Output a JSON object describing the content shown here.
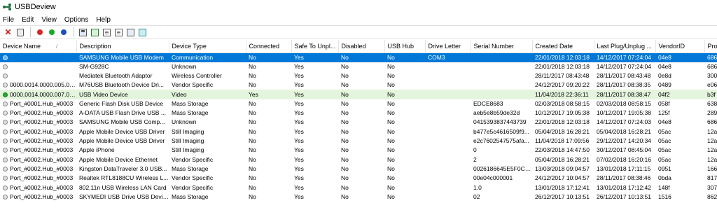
{
  "window": {
    "title": "USBDeview"
  },
  "menu": [
    "File",
    "Edit",
    "View",
    "Options",
    "Help"
  ],
  "toolbar": {
    "icons": [
      "uninstall-icon",
      "trash-icon",
      "red-dot-icon",
      "green-dot-icon",
      "blue-dot-icon",
      "save-icon",
      "refresh-icon",
      "copy-icon",
      "report-icon",
      "properties-icon",
      "exit-icon"
    ]
  },
  "table": {
    "sort_indicator": "/",
    "columns": [
      "Device Name",
      "Description",
      "Device Type",
      "Connected",
      "Safe To Unpl...",
      "Disabled",
      "USB Hub",
      "Drive Letter",
      "Serial Number",
      "Created Date",
      "Last Plug/Unplug ...",
      "VendorID",
      "Pro"
    ],
    "rows": [
      {
        "state": "selected",
        "cells": [
          "",
          "SAMSUNG Mobile USB Modem",
          "Communication",
          "No",
          "Yes",
          "No",
          "No",
          "COM3",
          "",
          "22/01/2018 12:03:18",
          "14/12/2017 07:24:04",
          "04e8",
          "686"
        ]
      },
      {
        "state": "",
        "cells": [
          "",
          "SM-G928C",
          "Unknown",
          "No",
          "Yes",
          "No",
          "No",
          "",
          "",
          "22/01/2018 12:03:18",
          "14/12/2017 07:24:04",
          "04e8",
          "686"
        ]
      },
      {
        "state": "",
        "cells": [
          "",
          "Mediatek Bluetooth Adaptor",
          "Wireless Controller",
          "No",
          "Yes",
          "No",
          "No",
          "",
          "",
          "28/11/2017 08:43:48",
          "28/11/2017 08:43:48",
          "0e8d",
          "300"
        ]
      },
      {
        "state": "",
        "cells": [
          "0000.0014.0000.005.00...",
          "M76USB Bluetooth Device Dri...",
          "Vendor Specific",
          "No",
          "Yes",
          "No",
          "No",
          "",
          "",
          "24/12/2017 09:20:22",
          "28/11/2017 08:38:35",
          "0489",
          "e06"
        ]
      },
      {
        "state": "connected",
        "cells": [
          "0000.0014.0000.007.00...",
          "USB Video Device",
          "Video",
          "Yes",
          "Yes",
          "No",
          "No",
          "",
          "",
          "11/04/2018 22:36:11",
          "28/11/2017 08:38:47",
          "04f2",
          "b3f"
        ]
      },
      {
        "state": "",
        "cells": [
          "Port_#0001.Hub_#0003",
          "Generic Flash Disk USB Device",
          "Mass Storage",
          "No",
          "Yes",
          "No",
          "No",
          "",
          "EDCE8683",
          "02/03/2018 08:58:15",
          "02/03/2018 08:58:15",
          "058f",
          "638"
        ]
      },
      {
        "state": "",
        "cells": [
          "Port_#0002.Hub_#0003",
          "A-DATA USB Flash Drive USB ...",
          "Mass Storage",
          "No",
          "Yes",
          "No",
          "No",
          "",
          "aeb5e8b59de32d",
          "10/12/2017 19:05:38",
          "10/12/2017 19:05:38",
          "125f",
          "289"
        ]
      },
      {
        "state": "",
        "cells": [
          "Port_#0002.Hub_#0003",
          "SAMSUNG Mobile USB Comp...",
          "Unknown",
          "No",
          "Yes",
          "No",
          "No",
          "",
          "0415393837443739",
          "22/01/2018 12:03:18",
          "14/12/2017 07:24:03",
          "04e8",
          "686"
        ]
      },
      {
        "state": "",
        "cells": [
          "Port_#0002.Hub_#0003",
          "Apple Mobile Device USB Driver",
          "Still Imaging",
          "No",
          "Yes",
          "No",
          "No",
          "",
          "b477e5c4616509f9...",
          "05/04/2018 16:28:21",
          "05/04/2018 16:28:21",
          "05ac",
          "12a"
        ]
      },
      {
        "state": "",
        "cells": [
          "Port_#0002.Hub_#0003",
          "Apple Mobile Device USB Driver",
          "Still Imaging",
          "No",
          "Yes",
          "No",
          "No",
          "",
          "e2c7602547575afa...",
          "11/04/2018 17:09:56",
          "29/12/2017 14:20:34",
          "05ac",
          "12a"
        ]
      },
      {
        "state": "",
        "cells": [
          "Port_#0002.Hub_#0003",
          "Apple iPhone",
          "Still Imaging",
          "No",
          "Yes",
          "No",
          "No",
          "",
          "0",
          "22/03/2018 14:47:50",
          "30/12/2017 08:45:04",
          "05ac",
          "12a"
        ]
      },
      {
        "state": "",
        "cells": [
          "Port_#0002.Hub_#0003",
          "Apple Mobile Device Ethernet",
          "Vendor Specific",
          "No",
          "Yes",
          "No",
          "No",
          "",
          "2",
          "05/04/2018 16:28:21",
          "07/02/2018 16:20:16",
          "05ac",
          "12a"
        ]
      },
      {
        "state": "",
        "cells": [
          "Port_#0002.Hub_#0003",
          "Kingston DataTraveler 3.0 USB...",
          "Mass Storage",
          "No",
          "Yes",
          "No",
          "No",
          "",
          "0026186645E5F0C1...",
          "13/03/2018 09:04:57",
          "13/01/2018 17:11:15",
          "0951",
          "166"
        ]
      },
      {
        "state": "",
        "cells": [
          "Port_#0002.Hub_#0003",
          "Realtek RTL8188CU Wireless L...",
          "Vendor Specific",
          "No",
          "Yes",
          "No",
          "No",
          "",
          "00e04c000001",
          "24/12/2017 10:04:57",
          "28/11/2017 08:38:46",
          "0bda",
          "817"
        ]
      },
      {
        "state": "",
        "cells": [
          "Port_#0002.Hub_#0003",
          "802.11n USB Wireless LAN Card",
          "Vendor Specific",
          "No",
          "Yes",
          "No",
          "No",
          "",
          "1.0",
          "13/01/2018 17:12:41",
          "13/01/2018 17:12:42",
          "148f",
          "307"
        ]
      },
      {
        "state": "",
        "cells": [
          "Port_#0002.Hub_#0003",
          "SKYMEDI USB Drive USB Device",
          "Mass Storage",
          "No",
          "Yes",
          "No",
          "No",
          "",
          "02",
          "26/12/2017 10:13:51",
          "26/12/2017 10:13:51",
          "1516",
          "862"
        ]
      }
    ]
  }
}
